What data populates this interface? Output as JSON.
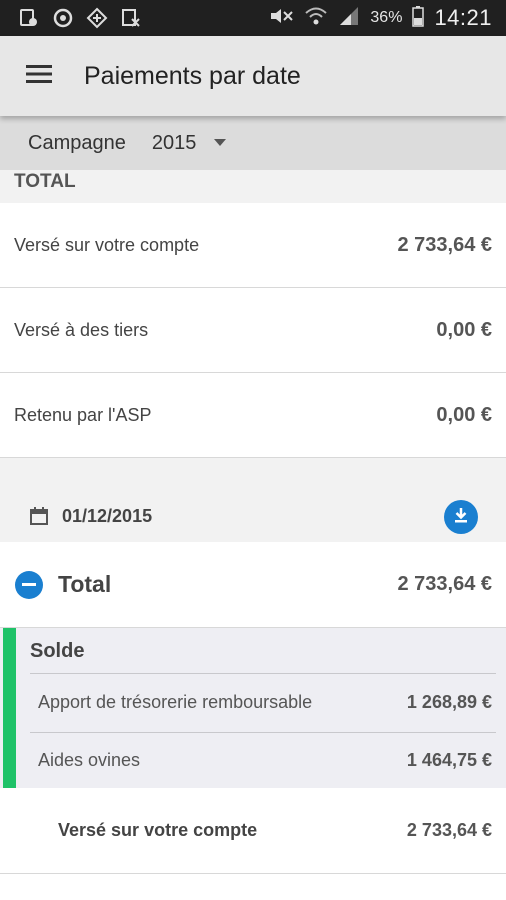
{
  "status_bar": {
    "battery_percent": "36%",
    "time": "14:21",
    "icons": [
      "notification-app-icon",
      "sync-icon",
      "app-icon",
      "excel-icon",
      "mute-icon",
      "wifi-icon",
      "signal-icon",
      "battery-icon"
    ]
  },
  "app_bar": {
    "title": "Paiements par date",
    "menu_icon": "hamburger-menu-icon"
  },
  "campaign": {
    "label": "Campagne",
    "selected": "2015"
  },
  "summary": {
    "heading": "TOTAL",
    "rows": [
      {
        "label": "Versé sur votre compte",
        "value": "2 733,64 €"
      },
      {
        "label": "Versé à des tiers",
        "value": "0,00 €"
      },
      {
        "label": "Retenu par l'ASP",
        "value": "0,00 €"
      }
    ]
  },
  "payment_date": {
    "date": "01/12/2015",
    "calendar_icon": "calendar-icon",
    "download_icon": "download-icon"
  },
  "detail": {
    "title": "Total",
    "amount": "2 733,64 €",
    "solde": {
      "title": "Solde",
      "items": [
        {
          "label": "Apport de trésorerie remboursable",
          "value": "1 268,89 €"
        },
        {
          "label": "Aides ovines",
          "value": "1 464,75 €"
        }
      ]
    },
    "verse": {
      "label": "Versé sur votre compte",
      "value": "2 733,64 €"
    }
  },
  "colors": {
    "accent_blue": "#1a7fd0",
    "solde_green": "#1fc268",
    "status_bar": "#202020"
  }
}
